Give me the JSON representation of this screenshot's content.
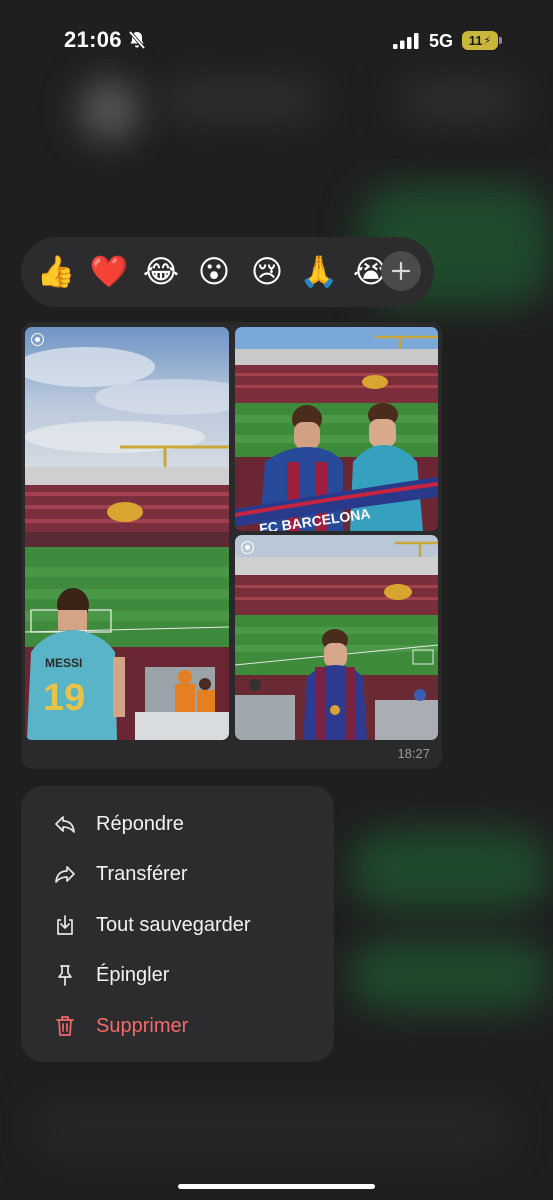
{
  "status": {
    "time": "21:06",
    "network": "5G",
    "battery": "11"
  },
  "reactions": {
    "emojis": [
      "👍",
      "❤️",
      "😂",
      "😮",
      "😢",
      "🙏",
      "😭"
    ]
  },
  "message": {
    "timestamp": "18:27"
  },
  "menu": {
    "reply": "Répondre",
    "forward": "Transférer",
    "save_all": "Tout sauvegarder",
    "pin": "Épingler",
    "delete": "Supprimer"
  },
  "photos": {
    "p1_jersey_name": "MESSI",
    "p1_jersey_number": "19",
    "p2_scarf": "FC BARCELONA"
  },
  "colors": {
    "danger": "#f16b6b",
    "battery": "#c9b73a",
    "surface": "#2c2c2e"
  }
}
